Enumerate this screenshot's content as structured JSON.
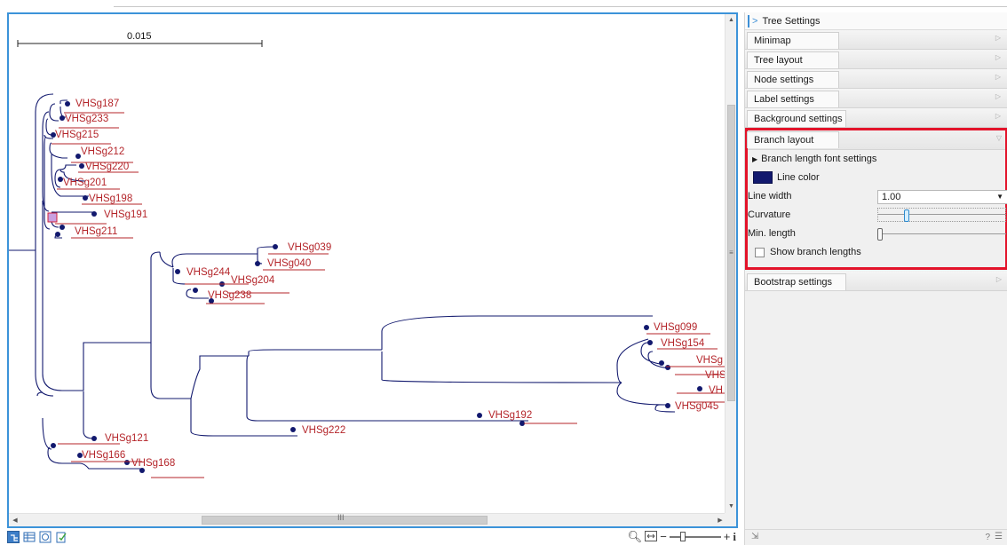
{
  "tree": {
    "scale_bar_value": "0.015",
    "line_color": "#12196e",
    "label_color": "#b4252a",
    "tip_labels": [
      "VHSg187",
      "VHSg233",
      "VHSg215",
      "VHSg212",
      "VHSg220",
      "VHSg201",
      "VHSg198",
      "VHSg191",
      "VHSg211",
      "VHSg039",
      "VHSg040",
      "VHSg244",
      "VHSg204",
      "VHSg238",
      "VHSg099",
      "VHSg154",
      "VHSg",
      "VHS",
      "VH",
      "VHSg045",
      "VHSg192",
      "VHSg222",
      "VHSg121",
      "VHSg166",
      "VHSg168"
    ]
  },
  "panel": {
    "title": "Tree Settings",
    "sections_top": [
      "Minimap",
      "Tree layout",
      "Node settings",
      "Label settings",
      "Background settings"
    ],
    "branch_layout": {
      "title": "Branch layout",
      "font_settings": "Branch length font settings",
      "line_color_label": "Line color",
      "line_color": "#12196e",
      "line_width_label": "Line width",
      "line_width_value": "1.00",
      "curvature_label": "Curvature",
      "min_length_label": "Min. length",
      "show_lengths_label": "Show branch lengths"
    },
    "bootstrap": "Bootstrap settings",
    "highlight_color": "#e3132a"
  },
  "toolbar": {
    "view_icons": [
      "tree-view-icon",
      "table-view-icon",
      "history-view-icon",
      "annotation-view-icon"
    ],
    "zoom_icons": [
      "zoom-magnifier-icon",
      "fit-width-icon",
      "zoom-out-icon",
      "zoom-in-icon",
      "info-icon"
    ]
  },
  "footer": {
    "help": "?"
  }
}
